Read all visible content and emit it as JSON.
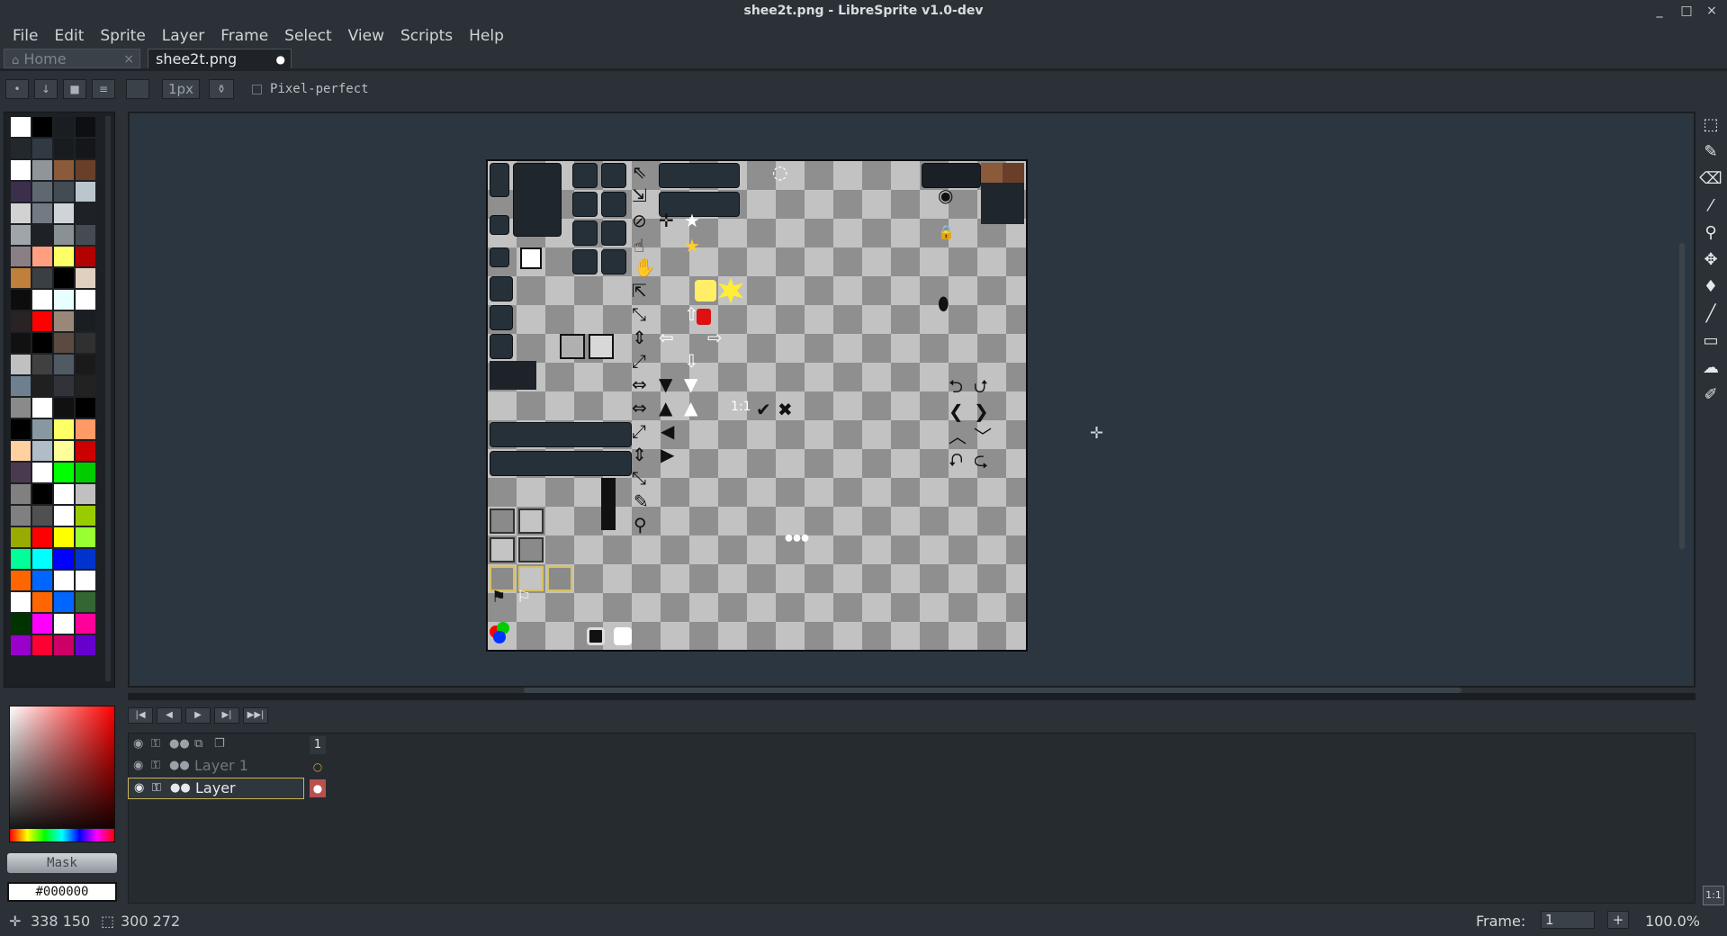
{
  "window": {
    "title": "shee2t.png - LibreSprite v1.0-dev",
    "controls": [
      "_",
      "□",
      "×"
    ]
  },
  "menu": [
    "File",
    "Edit",
    "Sprite",
    "Layer",
    "Frame",
    "Select",
    "View",
    "Scripts",
    "Help"
  ],
  "tabs": [
    {
      "label": "Home",
      "close": "×",
      "icon": "home-icon"
    },
    {
      "label": "shee2t.png",
      "close": "●"
    }
  ],
  "toolbar": {
    "brush_size": "1px",
    "pixel_perfect_label": "Pixel-perfect",
    "pixel_perfect_checked": false
  },
  "palette": {
    "colors": [
      "#ffffff",
      "#000000",
      "#1a1d21",
      "#0d0f12",
      "#22282e",
      "#313a42",
      "#181c20",
      "#141619",
      "#ffffff",
      "#8f959a",
      "#8a5a3a",
      "#6a3f2a",
      "#3c2f4e",
      "#5f6770",
      "#434b53",
      "#bac5cc",
      "#d2d2d2",
      "#727a82",
      "#cfd4d8",
      "#1e2226",
      "#a0a5aa",
      "#1e2226",
      "#8a9196",
      "#444b52",
      "#8a7f85",
      "#ff9f80",
      "#ffff66",
      "#b30000",
      "#c07f3a",
      "#3a3f44",
      "#000000",
      "#e0d0c0",
      "#0d0d0d",
      "#ffffff",
      "#e8ffff",
      "#ffffff",
      "#2a2323",
      "#ff0000",
      "#998877",
      "#1a1d21",
      "#111111",
      "#000000",
      "#5a4a40",
      "#303030",
      "#c0c0c0",
      "#404040",
      "#505a62",
      "#1a1a1a",
      "#6e8090",
      "#202020",
      "#303438",
      "#222222",
      "#8a8a8a",
      "#ffffff",
      "#111111",
      "#000000",
      "#000000",
      "#8898a0",
      "#ffff66",
      "#ff9966",
      "#ffd0a0",
      "#b0bcc8",
      "#ffff99",
      "#cc0000",
      "#4a3a50",
      "#ffffff",
      "#00ff00",
      "#00cc00",
      "#808080",
      "#000000",
      "#ffffff",
      "#c0c0c0",
      "#808080",
      "#505050",
      "#ffffff",
      "#99cc00",
      "#99aa00",
      "#ff0000",
      "#ffff00",
      "#99ff33",
      "#00ff99",
      "#00ffff",
      "#0000ff",
      "#0033cc",
      "#ff6600",
      "#0066ff",
      "#ffffff",
      "#ffffff",
      "#ffffff",
      "#ff6600",
      "#0066ff",
      "#336633",
      "#003300",
      "#ff00ff",
      "#ffffff",
      "#ff0099",
      "#9900cc",
      "#ff0033",
      "#cc0066",
      "#6600cc"
    ]
  },
  "tools": [
    {
      "name": "rectangular-marquee-icon",
      "glyph": "⬚"
    },
    {
      "name": "pencil-icon",
      "glyph": "✎"
    },
    {
      "name": "eraser-icon",
      "glyph": "⌫"
    },
    {
      "name": "eyedropper-icon",
      "glyph": "⁄"
    },
    {
      "name": "zoom-icon",
      "glyph": "⚲"
    },
    {
      "name": "move-icon",
      "glyph": "✥"
    },
    {
      "name": "fill-icon",
      "glyph": "♦"
    },
    {
      "name": "line-icon",
      "glyph": "╱"
    },
    {
      "name": "rectangle-icon",
      "glyph": "▭"
    },
    {
      "name": "blur-icon",
      "glyph": "☁"
    },
    {
      "name": "spray-icon",
      "glyph": "✐"
    }
  ],
  "color": {
    "mask_label": "Mask",
    "hex": "#000000"
  },
  "animation": {
    "buttons": [
      "|◀",
      "◀",
      "▶",
      "▶|",
      "▶▶|"
    ]
  },
  "layers": {
    "frame_header": "1",
    "rows": [
      {
        "name": "Layer 1",
        "active": false
      },
      {
        "name": "Layer",
        "active": true
      }
    ]
  },
  "zoom_fit_label": "1:1",
  "status": {
    "cursor_pos": "338 150",
    "sprite_size": "300 272",
    "frame_label": "Frame:",
    "frame_value": "1",
    "frame_add": "+",
    "zoom": "100.0%"
  },
  "sprite_sheet": {
    "highlight_colors": {
      "yellow": "#ffee66",
      "red": "#dd1111",
      "brown": "#8a5a3a"
    }
  }
}
